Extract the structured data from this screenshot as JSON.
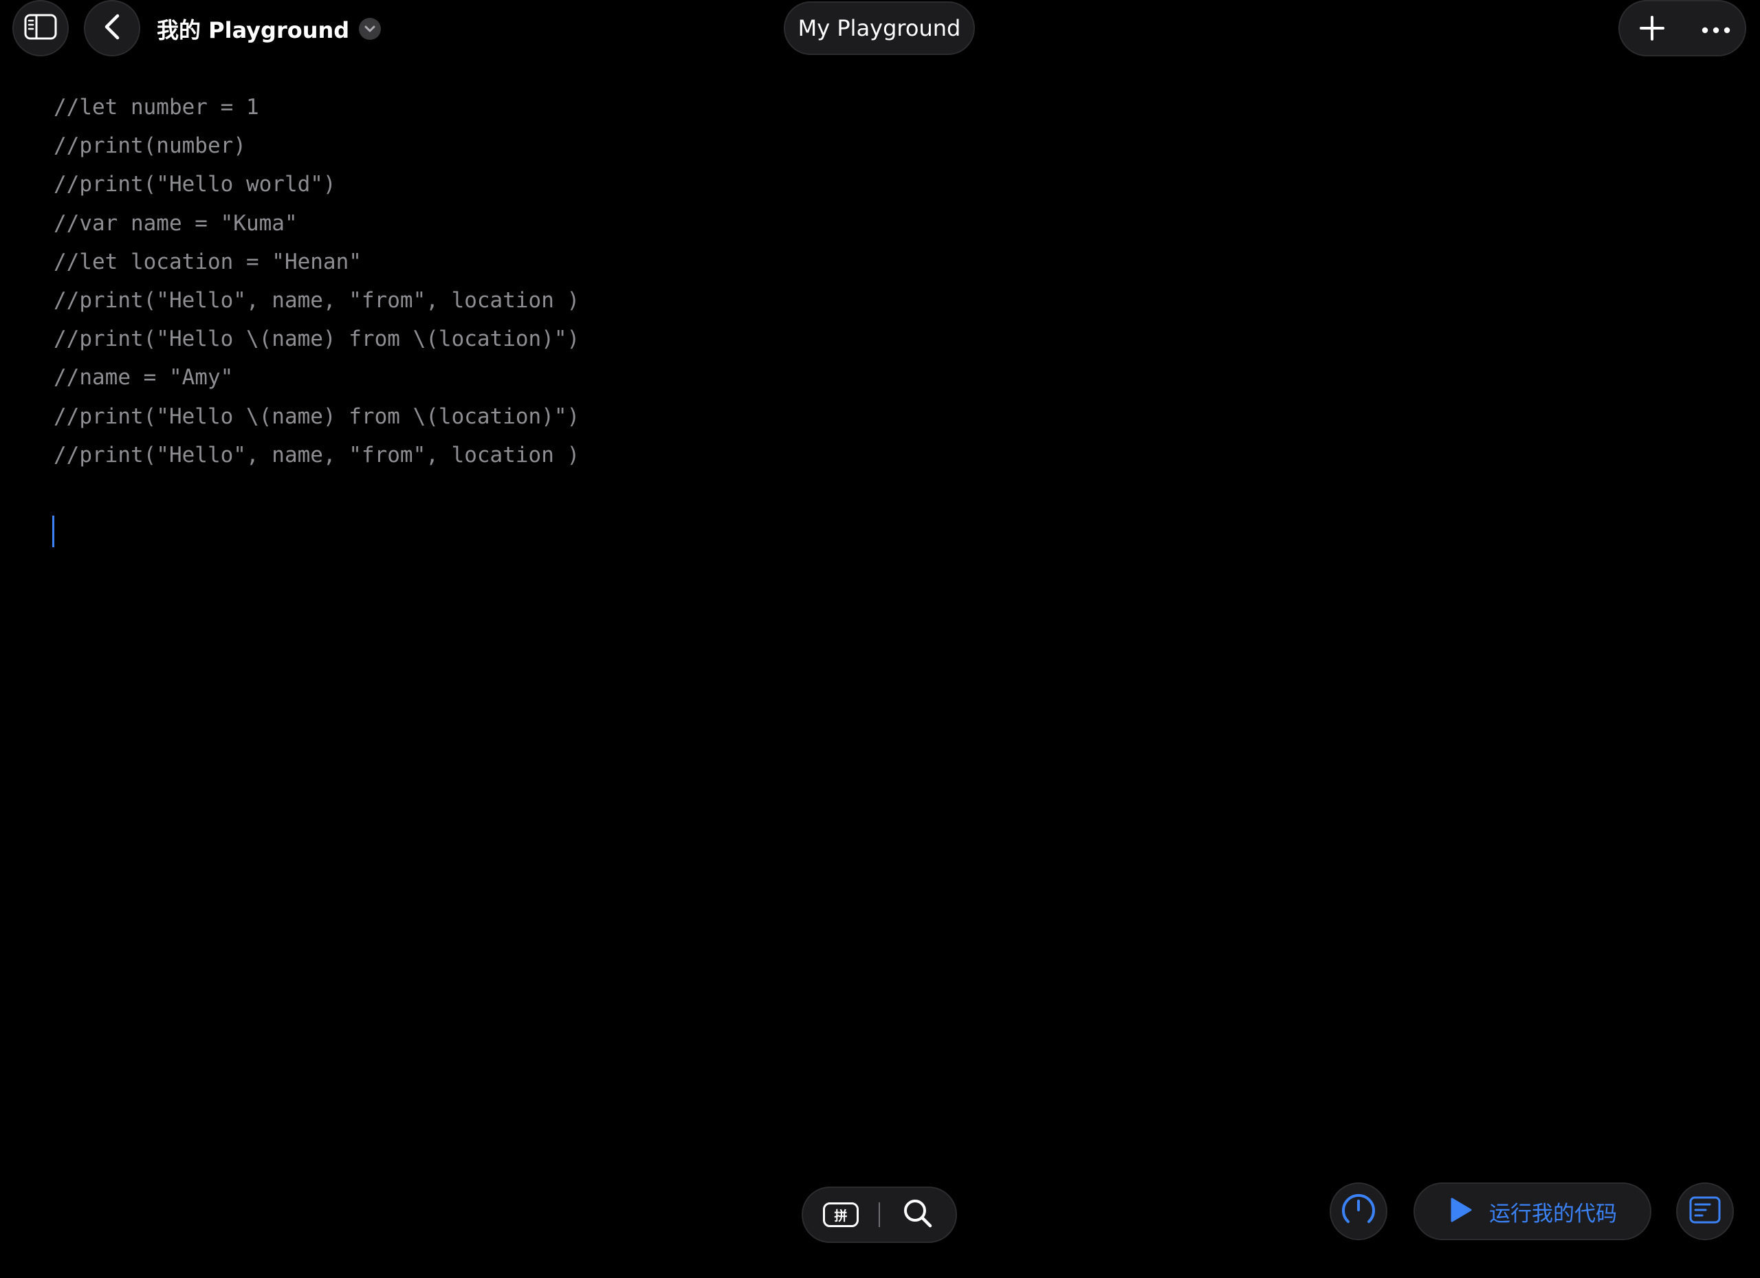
{
  "header": {
    "title": "我的 Playground",
    "center_title": "My Playground"
  },
  "editor": {
    "lines": [
      "//let number = 1",
      "//print(number)",
      "//print(\"Hello world\")",
      "//var name = \"Kuma\"",
      "//let location = \"Henan\"",
      "//print(\"Hello\", name, \"from\", location )",
      "//print(\"Hello \\(name) from \\(location)\")",
      "//name = \"Amy\"",
      "//print(\"Hello \\(name) from \\(location)\")",
      "//print(\"Hello\", name, \"from\", location )",
      ""
    ]
  },
  "bottom": {
    "ime_key_label": "拼",
    "run_label": "运行我的代码"
  },
  "icons": {
    "sidebar_toggle": "sidebar-icon",
    "back": "chevron-left-icon",
    "title_menu": "chevron-down-icon",
    "add": "plus-icon",
    "more": "ellipsis-icon",
    "keyboard_ime": "keyboard-pinyin-icon",
    "search": "search-icon",
    "gauge": "gauge-icon",
    "run": "play-icon",
    "console": "console-icon"
  },
  "colors": {
    "background": "#000000",
    "control_fill": "#1c1c1e",
    "code_text": "#8e8e93",
    "accent": "#3b82f6"
  }
}
